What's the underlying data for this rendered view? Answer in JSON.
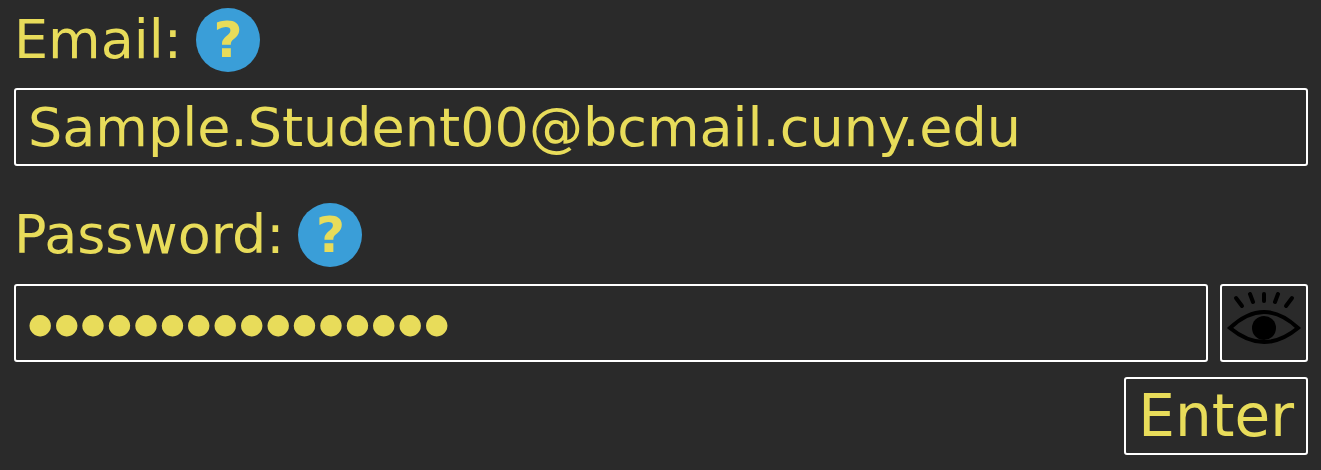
{
  "email": {
    "label": "Email:",
    "help_icon": "?",
    "value": "Sample.Student00@bcmail.cuny.edu"
  },
  "password": {
    "label": "Password:",
    "help_icon": "?",
    "value": "●●●●●●●●●●●●●●●●"
  },
  "enter_button": "Enter"
}
